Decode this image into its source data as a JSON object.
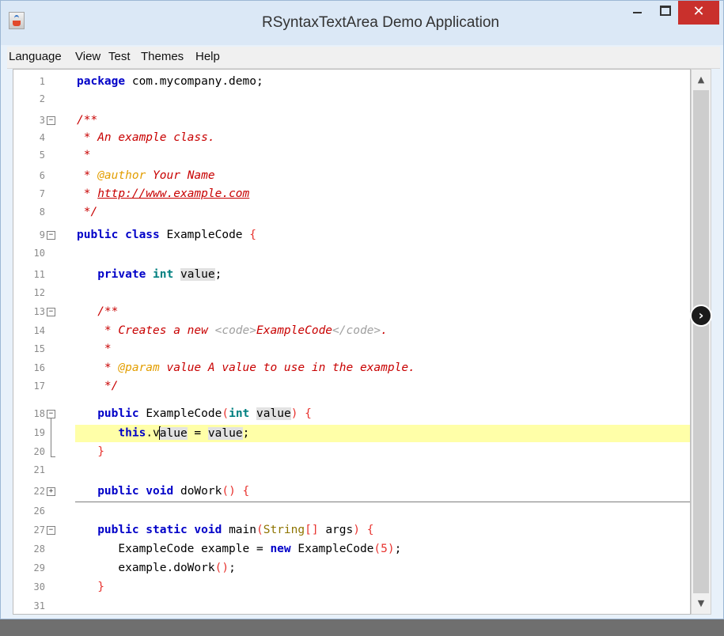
{
  "window": {
    "title": "RSyntaxTextArea Demo Application",
    "close_glyph": "✕"
  },
  "menu": {
    "items": [
      "Language",
      "View",
      "Test",
      "Themes",
      "Help"
    ]
  },
  "editor": {
    "line_numbers": [
      "1",
      "2",
      "3",
      "4",
      "5",
      "6",
      "7",
      "8",
      "9",
      "10",
      "11",
      "12",
      "13",
      "14",
      "15",
      "16",
      "17",
      "18",
      "19",
      "20",
      "21",
      "22",
      "26",
      "27",
      "28",
      "29",
      "30",
      "31"
    ],
    "current_line": "19",
    "code": {
      "l1_kw": "package",
      "l1_rest": " com.mycompany.demo;",
      "l3": "/**",
      "l4": " * An example class.",
      "l5": " *",
      "l6_star": " * ",
      "l6_tag": "@author",
      "l6_rest": " Your Name",
      "l7_star": " * ",
      "l7_link": "http://www.example.com",
      "l8": " */",
      "l9_kw": "public class",
      "l9_name": " ExampleCode ",
      "l9_brace": "{",
      "l11_indent": "   ",
      "l11_kw": "private",
      "l11_type": "int",
      "l11_var": "value",
      "l11_semi": ";",
      "l13": "   /**",
      "l14_a": "    * Creates a new ",
      "l14_tag1": "<code>",
      "l14_name": "ExampleCode",
      "l14_tag2": "</code>",
      "l14_end": ".",
      "l15": "    *",
      "l16_a": "    * ",
      "l16_tag": "@param",
      "l16_rest": " value A value to use in the example.",
      "l17": "    */",
      "l18_indent": "   ",
      "l18_kw": "public",
      "l18_name": " ExampleCode",
      "l18_paren1": "(",
      "l18_type": "int",
      "l18_var": "value",
      "l18_paren2": ")",
      "l18_brace": "{",
      "l19_indent": "      ",
      "l19_kw": "this",
      "l19_dot": ".v",
      "l19_after": "alue",
      "l19_eq": " = ",
      "l19_var": "value",
      "l19_semi": ";",
      "l20": "   }",
      "l22_indent": "   ",
      "l22_kw": "public void",
      "l22_name": " doWork",
      "l22_paren": "()",
      "l22_brace": "{",
      "l27_indent": "   ",
      "l27_kw": "public static void",
      "l27_name": " main",
      "l27_p1": "(",
      "l27_type": "String",
      "l27_arr": "[]",
      "l27_args": " args",
      "l27_p2": ")",
      "l27_brace": "{",
      "l28_a": "      ExampleCode example = ",
      "l28_kw": "new",
      "l28_b": " ExampleCode",
      "l28_p1": "(",
      "l28_num": "5",
      "l28_p2": ")",
      "l28_semi": ";",
      "l29_a": "      example.doWork",
      "l29_p": "()",
      "l29_semi": ";",
      "l30": "   }"
    }
  },
  "scrollbar": {
    "up": "▲",
    "down": "▼"
  },
  "float_button": {
    "glyph": "›"
  },
  "colors": {
    "keyword": "#0000c8",
    "comment": "#c80000",
    "type": "#008080",
    "current_line": "#ffffa8"
  }
}
